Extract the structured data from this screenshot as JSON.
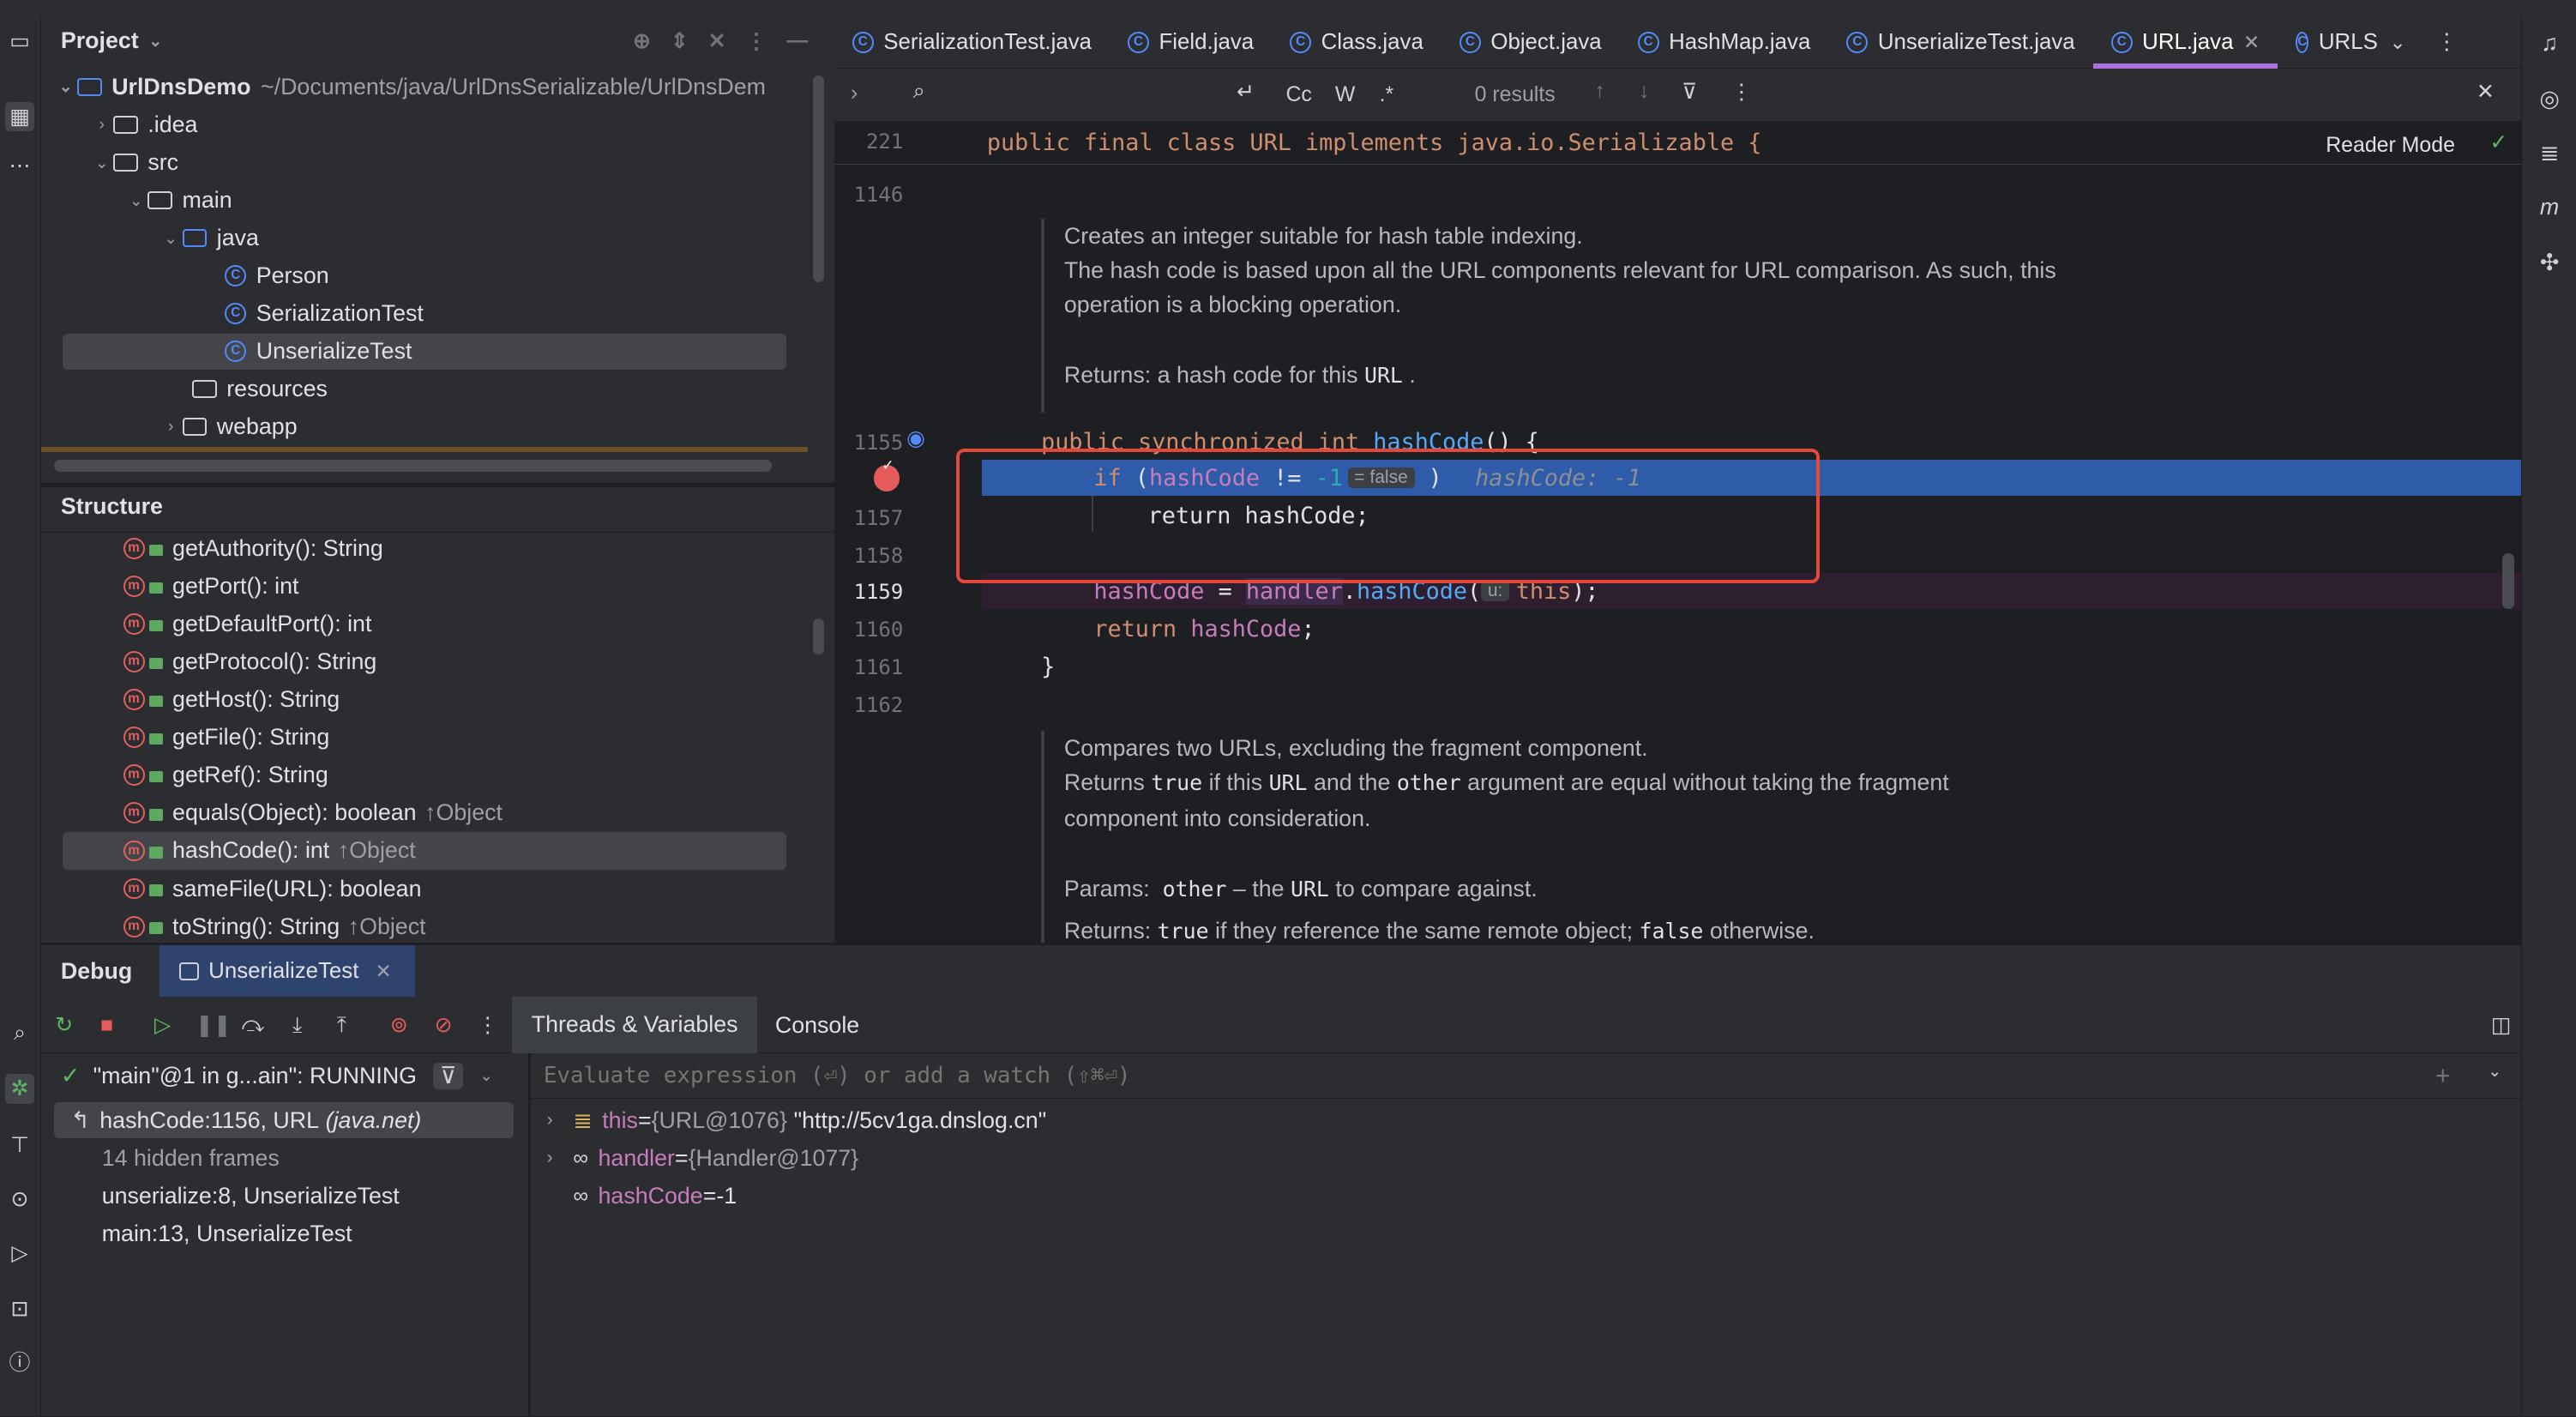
{
  "project_panel": {
    "title": "Project",
    "tree": [
      {
        "label": "UrlDnsDemo",
        "path": "~/Documents/java/UrlDnsSerializable/UrlDnsDem"
      },
      {
        "label": ".idea"
      },
      {
        "label": "src"
      },
      {
        "label": "main"
      },
      {
        "label": "java"
      },
      {
        "label": "Person"
      },
      {
        "label": "SerializationTest"
      },
      {
        "label": "UnserializeTest"
      },
      {
        "label": "resources"
      },
      {
        "label": "webapp"
      }
    ]
  },
  "structure_panel": {
    "title": "Structure",
    "items": [
      {
        "label": "getAuthority(): String",
        "extra": ""
      },
      {
        "label": "getPort(): int",
        "extra": ""
      },
      {
        "label": "getDefaultPort(): int",
        "extra": ""
      },
      {
        "label": "getProtocol(): String",
        "extra": ""
      },
      {
        "label": "getHost(): String",
        "extra": ""
      },
      {
        "label": "getFile(): String",
        "extra": ""
      },
      {
        "label": "getRef(): String",
        "extra": ""
      },
      {
        "label": "equals(Object): boolean",
        "extra": "↑Object"
      },
      {
        "label": "hashCode(): int",
        "extra": "↑Object"
      },
      {
        "label": "sameFile(URL): boolean",
        "extra": ""
      },
      {
        "label": "toString(): String",
        "extra": "↑Object"
      }
    ]
  },
  "tabs": [
    "SerializationTest.java",
    "Field.java",
    "Class.java",
    "Object.java",
    "HashMap.java",
    "UnserializeTest.java",
    "URL.java",
    "URLS"
  ],
  "find_bar": {
    "options": [
      "Cc",
      "W",
      ".*"
    ],
    "results": "0 results"
  },
  "editor": {
    "reader_mode": "Reader Mode",
    "line_numbers": [
      "221",
      "1146",
      "1155",
      "1157",
      "1158",
      "1159",
      "1160",
      "1161",
      "1162"
    ],
    "sticky_code": "public final class URL implements java.io.Serializable {",
    "doc1_lines": [
      "Creates an integer suitable for hash table indexing.",
      "The hash code is based upon all the URL components relevant for URL comparison. As such, this",
      "operation is a blocking operation."
    ],
    "doc1_returns_label": "Returns:",
    "doc1_returns_text": "a hash code for this",
    "doc1_returns_code": "URL",
    "doc1_returns_end": ".",
    "method_sig_kw": "public synchronized int",
    "method_sig_name": "hashCode",
    "method_sig_end": "() {",
    "if_kw": "if",
    "if_open": " (",
    "if_field": "hashCode",
    "if_op": " != ",
    "if_num": "-1",
    "if_hint": "= false",
    "if_close": " )",
    "if_inline_value": "hashCode: -1",
    "return_line": "return hashCode;",
    "assign_field": "hashCode",
    "assign_eq": " = ",
    "assign_handler": "handler",
    "assign_dot": ".",
    "assign_call": "hashCode",
    "assign_open": "(",
    "assign_hint": "u:",
    "assign_this": "this",
    "assign_close": ");",
    "return2_kw": "return",
    "return2_field": "hashCode",
    "return2_end": ";",
    "close_brace": "}",
    "doc2_line1": "Compares two URLs, excluding the fragment component.",
    "doc2_l2_a": "Returns",
    "doc2_l2_b": "true",
    "doc2_l2_c": "if this",
    "doc2_l2_d": "URL",
    "doc2_l2_e": "and the",
    "doc2_l2_f": "other",
    "doc2_l2_g": "argument are equal without taking the fragment",
    "doc2_line3": "component into consideration.",
    "doc2_params_label": "Params:",
    "doc2_params_code": "other",
    "doc2_params_text": "– the",
    "doc2_params_code2": "URL",
    "doc2_params_end": "to compare against.",
    "doc2_returns_label": "Returns:",
    "doc2_returns_code": "true",
    "doc2_returns_text": "if they reference the same remote object;",
    "doc2_returns_code2": "false",
    "doc2_returns_end": "otherwise."
  },
  "debug": {
    "title": "Debug",
    "session_tab": "UnserializeTest",
    "tabs": [
      "Threads & Variables",
      "Console"
    ],
    "thread": "\"main\"@1 in g...ain\": RUNNING",
    "frames": [
      {
        "label": "hashCode:1156, URL",
        "pkg": "(java.net)"
      },
      {
        "label": "14 hidden frames",
        "pkg": ""
      },
      {
        "label": "unserialize:8, UnserializeTest",
        "pkg": ""
      },
      {
        "label": "main:13, UnserializeTest",
        "pkg": ""
      }
    ],
    "eval_placeholder": "Evaluate expression (⏎) or add a watch (⇧⌘⏎)",
    "variables": [
      {
        "name": "this",
        "eq": " = ",
        "type": "{URL@1076}",
        "value": "\"http://5cv1ga.dnslog.cn\""
      },
      {
        "name": "handler",
        "eq": " = ",
        "type": "{Handler@1077}",
        "value": ""
      },
      {
        "name": "hashCode",
        "eq": " = ",
        "type": "",
        "value": "-1"
      }
    ]
  },
  "colors": {
    "highlight_line": "#2e5ca8",
    "exec_line": "#2d1f2f",
    "annotation_box": "#e5473b",
    "accent_tab": "#b070e0"
  }
}
